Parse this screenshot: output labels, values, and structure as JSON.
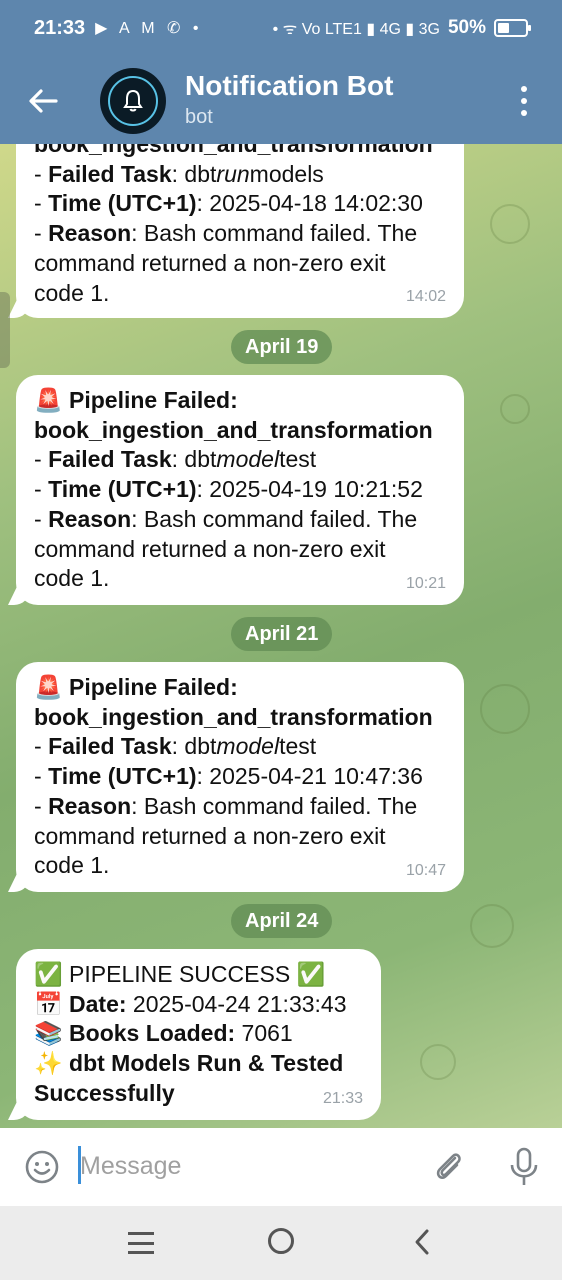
{
  "status_bar": {
    "time": "21:33",
    "left_icons": "▶ A M ✆ •",
    "network": "• ᯤ Vo LTE1 ▮ 4G ▮ 3G",
    "battery_percent": "50%",
    "battery_level": 0.5
  },
  "header": {
    "title": "Notification Bot",
    "subtitle": "bot",
    "back_icon": "arrow-left-icon",
    "menu_icon": "more-vertical-icon",
    "avatar_icon": "bell-icon"
  },
  "messages": [
    {
      "lines": [
        {
          "bold": "book_ingestion_and_transformation",
          "rest": ""
        },
        {
          "prefix": "- ",
          "bold": "Failed Task",
          "rest": ": dbt",
          "italic": "run",
          "tail": "models"
        },
        {
          "prefix": "- ",
          "bold": "Time (UTC+1)",
          "rest": ": 2025-04-18 14:02:30"
        },
        {
          "prefix": "- ",
          "bold": "Reason",
          "rest": ": Bash command failed. The"
        },
        {
          "rest": "command returned a non-zero exit"
        },
        {
          "rest": "code 1."
        }
      ],
      "time": "14:02"
    },
    {
      "date": "April 19",
      "lines": [
        {
          "emoji": "🚨",
          "bold": "Pipeline Failed:"
        },
        {
          "bold": "book_ingestion_and_transformation"
        },
        {
          "prefix": "- ",
          "bold": "Failed Task",
          "rest": ": dbt",
          "italic": "model",
          "tail": "test"
        },
        {
          "prefix": "- ",
          "bold": "Time (UTC+1)",
          "rest": ": 2025-04-19 10:21:52"
        },
        {
          "prefix": "- ",
          "bold": "Reason",
          "rest": ": Bash command failed. The"
        },
        {
          "rest": "command returned a non-zero exit"
        },
        {
          "rest": "code 1."
        }
      ],
      "time": "10:21"
    },
    {
      "date": "April 21",
      "lines": [
        {
          "emoji": "🚨",
          "bold": "Pipeline Failed:"
        },
        {
          "bold": "book_ingestion_and_transformation"
        },
        {
          "prefix": "- ",
          "bold": "Failed Task",
          "rest": ": dbt",
          "italic": "model",
          "tail": "test"
        },
        {
          "prefix": "- ",
          "bold": "Time (UTC+1)",
          "rest": ": 2025-04-21 10:47:36"
        },
        {
          "prefix": "- ",
          "bold": "Reason",
          "rest": ": Bash command failed. The"
        },
        {
          "rest": "command returned a non-zero exit"
        },
        {
          "rest": "code 1."
        }
      ],
      "time": "10:47"
    },
    {
      "date": "April 24",
      "lines": [
        {
          "emoji": "✅",
          "rest": " PIPELINE SUCCESS ",
          "emoji2": "✅"
        },
        {
          "emoji": "📅",
          "bold": "Date:",
          "rest": " 2025-04-24 21:33:43"
        },
        {
          "emoji": "📚",
          "bold": "Books Loaded:",
          "rest": " 7061"
        },
        {
          "emoji": "✨",
          "bold": "dbt Models Run & Tested"
        },
        {
          "bold": "Successfully"
        }
      ],
      "time": "21:33"
    }
  ],
  "composer": {
    "placeholder": "Message",
    "emoji_icon": "smile-icon",
    "attach_icon": "paperclip-icon",
    "mic_icon": "microphone-icon"
  },
  "nav_bar": {
    "recent_icon": "recent-apps-icon",
    "home_icon": "home-icon",
    "back_icon": "back-icon"
  }
}
